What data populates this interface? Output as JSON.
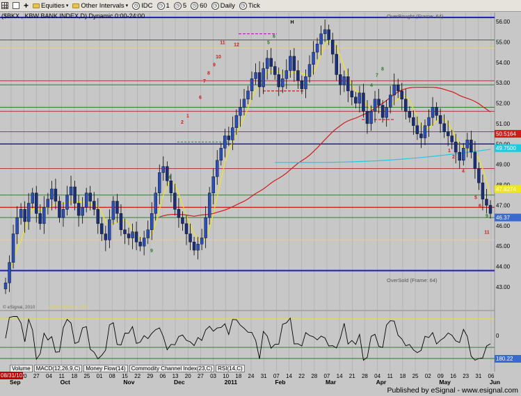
{
  "toolbar": {
    "items": [
      "Equities",
      "Other Intervals",
      "IDC",
      "1",
      "5",
      "60",
      "Daily",
      "Tick"
    ]
  },
  "chart_title": "($BKX , KBW BANK INDEX,D) Dynamic 0:00-24:00",
  "overbought_label": "OverBought (Frame: 64)",
  "oversold_label": "OverSold (Frame: 64)",
  "watermark": "© eSignal, 2010",
  "autoframe": "AutoFrame is OFF",
  "publisher": "Published by eSignal - www.esignal.com",
  "date_box": "08/31/10",
  "indicator_tabs": [
    "Volume",
    "MACD(12,26,9,C)",
    "Money Flow(14)",
    "Commodity Channel Index(23,C)",
    "RSI(14,C)"
  ],
  "price_axis": [
    "56.00",
    "55.00",
    "54.00",
    "53.00",
    "52.00",
    "51.00",
    "50.00",
    "49.00",
    "48.00",
    "47.00",
    "46.00",
    "45.00",
    "44.00",
    "43.00"
  ],
  "price_markers": {
    "red": "50.5164",
    "cyan": "49.7500",
    "yellow": "47.8274",
    "blue": "46.37",
    "rsi": "180.22",
    "rsi_zero": "0"
  },
  "month_labels": [
    "Sep",
    "Oct",
    "Nov",
    "Dec",
    "2011",
    "Feb",
    "Mar",
    "Apr",
    "May",
    "Jun"
  ],
  "day_labels": [
    "13",
    "20",
    "27",
    "04",
    "11",
    "18",
    "25",
    "01",
    "08",
    "15",
    "22",
    "29",
    "06",
    "13",
    "20",
    "27",
    "03",
    "10",
    "18",
    "24",
    "31",
    "07",
    "14",
    "22",
    "28",
    "07",
    "14",
    "21",
    "28",
    "04",
    "11",
    "18",
    "25",
    "02",
    "09",
    "16",
    "23",
    "31",
    "06"
  ],
  "annotations": [
    "H",
    "11",
    "12",
    "11",
    "10",
    "9",
    "8",
    "7",
    "6",
    "5",
    "4",
    "3",
    "2",
    "1",
    "8",
    "7",
    "6",
    "5",
    "4",
    "3",
    "2",
    "1",
    "1",
    "2",
    "3",
    "4",
    "5",
    "6",
    "7",
    "8",
    "9",
    "2",
    "3",
    "4",
    "5",
    "6",
    "7",
    "8",
    "9",
    "11",
    "9"
  ],
  "colors": {
    "background": "#c7c7c7",
    "up_bar": "#1f3f9e",
    "down_bar": "#1f3f9e",
    "ma_red": "#d21a1a",
    "ma_yellow": "#f0e61a",
    "cyan_line": "#20c8e0",
    "blue_line": "#1b1bb0",
    "green_line": "#3a7a3a"
  }
}
